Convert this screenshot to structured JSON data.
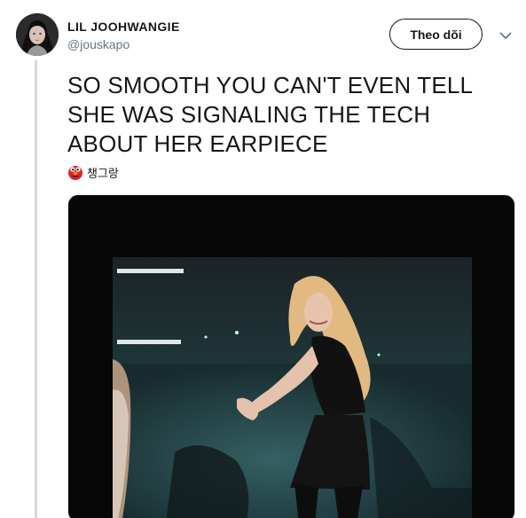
{
  "header": {
    "display_name": "LIL JOOHWANGIE",
    "handle": "@jouskapo",
    "follow_label": "Theo dõi"
  },
  "tweet": {
    "text": "SO SMOOTH YOU CAN'T EVEN TELL SHE WAS SIGNALING THE TECH ABOUT HER EARPIECE"
  },
  "reply": {
    "emoji_icon": "elmo-face-icon",
    "name": "챙그랑"
  },
  "media": {
    "type": "video-gif"
  },
  "colors": {
    "text": "#14171a",
    "secondary": "#657786",
    "thread_line": "#d5dbe0",
    "media_background": "#070707"
  }
}
